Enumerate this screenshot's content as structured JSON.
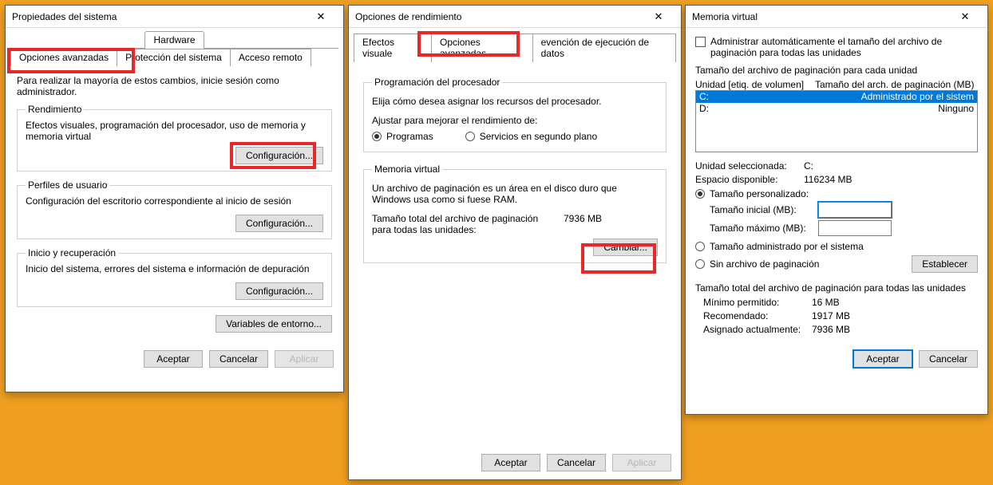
{
  "sysprops": {
    "title": "Propiedades del sistema",
    "tabs": {
      "hardware": "Hardware",
      "advanced": "Opciones avanzadas",
      "protection": "Protección del sistema",
      "remote": "Acceso remoto"
    },
    "admin_note": "Para realizar la mayoría de estos cambios, inicie sesión como administrador.",
    "perf": {
      "legend": "Rendimiento",
      "desc": "Efectos visuales, programación del procesador, uso de memoria y memoria virtual",
      "btn": "Configuración..."
    },
    "profiles": {
      "legend": "Perfiles de usuario",
      "desc": "Configuración del escritorio correspondiente al inicio de sesión",
      "btn": "Configuración..."
    },
    "recovery": {
      "legend": "Inicio y recuperación",
      "desc": "Inicio del sistema, errores del sistema e información de depuración",
      "btn": "Configuración..."
    },
    "env_btn": "Variables de entorno...",
    "buttons": {
      "ok": "Aceptar",
      "cancel": "Cancelar",
      "apply": "Aplicar"
    }
  },
  "perfopt": {
    "title": "Opciones de rendimiento",
    "tabs": {
      "visual": "Efectos visuale",
      "advanced": "Opciones avanzadas",
      "dep": "evención de ejecución de datos"
    },
    "proc": {
      "legend": "Programación del procesador",
      "desc": "Elija cómo desea asignar los recursos del procesador.",
      "adjust": "Ajustar para mejorar el rendimiento de:",
      "programs": "Programas",
      "services": "Servicios en segundo plano"
    },
    "vmem": {
      "legend": "Memoria virtual",
      "desc": "Un archivo de paginación es un área en el disco duro que Windows usa como si fuese RAM.",
      "total_lbl": "Tamaño total del archivo de paginación para todas las unidades:",
      "total_val": "7936 MB",
      "change_btn": "Cambiar..."
    },
    "buttons": {
      "ok": "Aceptar",
      "cancel": "Cancelar",
      "apply": "Aplicar"
    }
  },
  "vmdlg": {
    "title": "Memoria virtual",
    "auto_chk": "Administrar automáticamente el tamaño del archivo de paginación para todas las unidades",
    "listhdr": "Tamaño del archivo de paginación para cada unidad",
    "lv": {
      "col1": "Unidad [etiq. de volumen]",
      "col2": "Tamaño del arch. de paginación (MB)",
      "rows": [
        {
          "drive": "C:",
          "size": "Administrado por el sistem"
        },
        {
          "drive": "D:",
          "size": "Ninguno"
        }
      ]
    },
    "sel_lbl": "Unidad seleccionada:",
    "sel_val": "C:",
    "free_lbl": "Espacio disponible:",
    "free_val": "116234 MB",
    "custom": "Tamaño personalizado:",
    "init_lbl": "Tamaño inicial (MB):",
    "max_lbl": "Tamaño máximo (MB):",
    "sysmanaged": "Tamaño administrado por el sistema",
    "nopage": "Sin archivo de paginación",
    "set_btn": "Establecer",
    "totals_hdr": "Tamaño total del archivo de paginación para todas las unidades",
    "min_lbl": "Mínimo permitido:",
    "min_val": "16 MB",
    "rec_lbl": "Recomendado:",
    "rec_val": "1917 MB",
    "cur_lbl": "Asignado actualmente:",
    "cur_val": "7936 MB",
    "buttons": {
      "ok": "Aceptar",
      "cancel": "Cancelar"
    }
  }
}
